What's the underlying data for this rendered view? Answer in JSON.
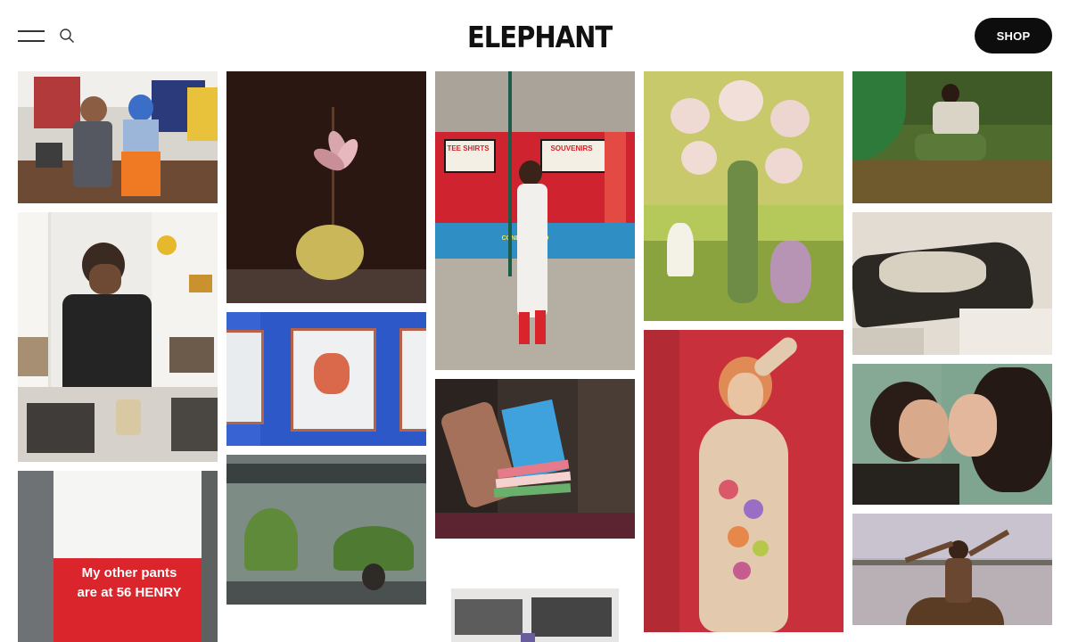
{
  "header": {
    "logo_text": "ELEPHANT",
    "shop_label": "SHOP",
    "menu_icon": "hamburger-menu-icon",
    "search_icon": "search-icon"
  },
  "gallery": {
    "columns": [
      [
        {
          "id": "artist-studio-portrait",
          "subject": "two people posing in a colorful art studio"
        },
        {
          "id": "tea-ceremony",
          "subject": "woman pouring tea in front of shelves"
        },
        {
          "id": "red-shorts",
          "subject": "person in white tee and red shorts",
          "text_lines": [
            "My other pants",
            "are at 56 HENRY"
          ]
        }
      ],
      [
        {
          "id": "flower-still-life",
          "subject": "pink flower stem in a melon on dark background"
        },
        {
          "id": "framed-prints",
          "subject": "framed prints on a blue wall"
        },
        {
          "id": "aquarium-van",
          "subject": "aquarium plants inside a van window"
        }
      ],
      [
        {
          "id": "coney-island-portrait",
          "subject": "woman in white dress and red boots at a souvenir stand",
          "signs": [
            "TEE SHIRTS",
            "SOUVENIRS",
            "CONEY ISLAND"
          ]
        },
        {
          "id": "books-in-hand",
          "subject": "tattooed hand holding a stack of books"
        },
        {
          "id": "car-collage",
          "subject": "black and white collage of cars"
        }
      ],
      [
        {
          "id": "garlic-tree-painting",
          "subject": "surreal painting of a tree with garlic blossoms"
        },
        {
          "id": "floral-nude-painting",
          "subject": "painted figure with flowers on red background"
        }
      ],
      [
        {
          "id": "field-portrait",
          "subject": "man sitting in grass among fallen leaves"
        },
        {
          "id": "rope-sculpture",
          "subject": "sepia photo of a rope-covered chaise"
        },
        {
          "id": "kiss-film-still",
          "subject": "two women kissing"
        },
        {
          "id": "boat-at-dusk",
          "subject": "woman with arms raised in a boat on a lake"
        }
      ]
    ]
  },
  "colors": {
    "header_bg": "#ffffff",
    "shop_button_bg": "#0d0d0d",
    "shop_button_text": "#ffffff",
    "icon_color": "#333333"
  }
}
